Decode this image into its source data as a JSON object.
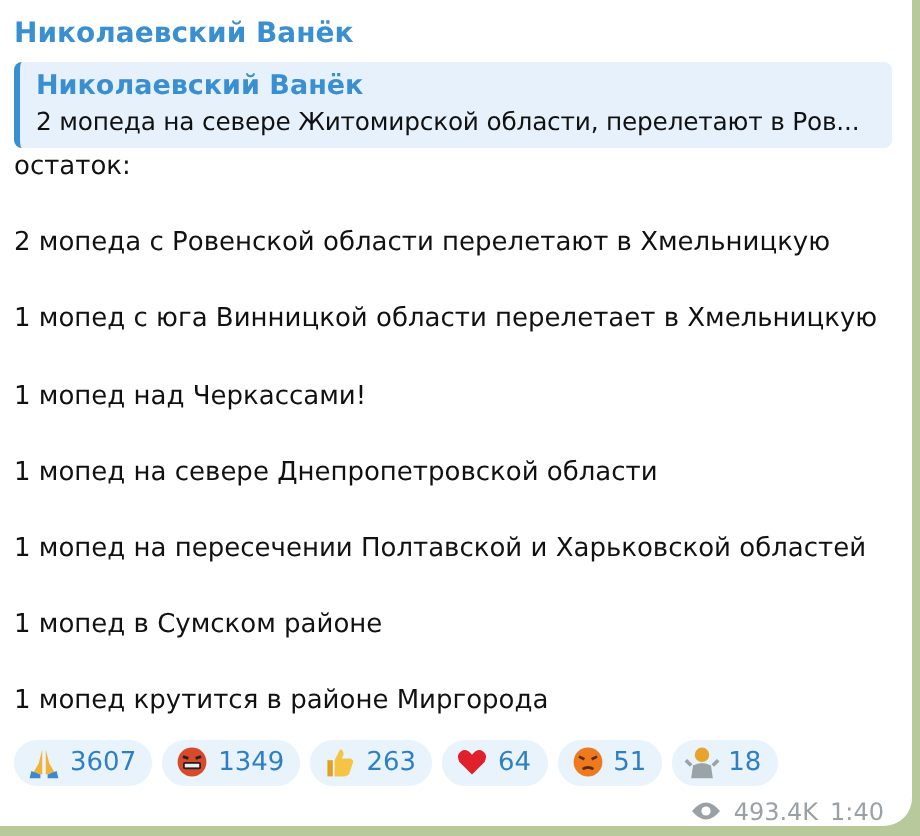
{
  "channel": "Николаевский Ванёк",
  "reply": {
    "author": "Николаевский Ванёк",
    "text": "2 мопеда на севере Житомирской области, перелетают в Ров..."
  },
  "paragraphs": [
    "остаток:",
    "2 мопеда с Ровенской области перелетают в Хмельницкую",
    "1 мопед с юга Винницкой области перелетает в Хмельницкую",
    "1 мопед над Черкассами!",
    "1 мопед на севере Днепропетровской области",
    "1 мопед на пересечении Полтавской и Харьковской областей",
    "1 мопед в Сумском районе",
    "1 мопед крутится в районе Миргорода"
  ],
  "reactions": [
    {
      "kind": "pray",
      "count": "3607"
    },
    {
      "kind": "cursing",
      "count": "1349"
    },
    {
      "kind": "thumbs",
      "count": "263"
    },
    {
      "kind": "heart",
      "count": "64"
    },
    {
      "kind": "angry",
      "count": "51"
    },
    {
      "kind": "shrug",
      "count": "18"
    }
  ],
  "views": "493.4K",
  "time": "1:40"
}
